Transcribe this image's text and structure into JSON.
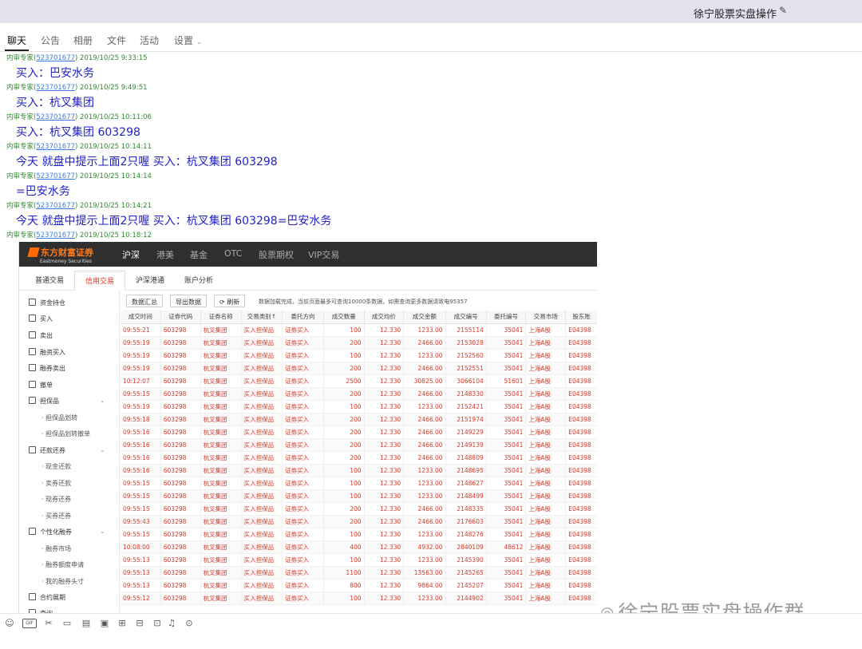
{
  "window": {
    "title": "徐宁股票实盘操作"
  },
  "tabs": [
    {
      "label": "聊天"
    },
    {
      "label": "公告"
    },
    {
      "label": "相册"
    },
    {
      "label": "文件"
    },
    {
      "label": "活动"
    },
    {
      "label": "设置"
    }
  ],
  "messages": [
    {
      "sender": "内审专家",
      "qq": "523701677",
      "time": "2019/10/25 9:33:15",
      "text": "买入：巴安水务"
    },
    {
      "sender": "内审专家",
      "qq": "523701677",
      "time": "2019/10/25 9:49:51",
      "text": "买入：杭叉集团"
    },
    {
      "sender": "内审专家",
      "qq": "523701677",
      "time": "2019/10/25 10:11:06",
      "text": "买入：杭叉集团 603298"
    },
    {
      "sender": "内审专家",
      "qq": "523701677",
      "time": "2019/10/25 10:14:11",
      "text": "今天 就盘中提示上面2只喔 买入：杭叉集团 603298"
    },
    {
      "sender": "内审专家",
      "qq": "523701677",
      "time": "2019/10/25 10:14:14",
      "text": "=巴安水务"
    },
    {
      "sender": "内审专家",
      "qq": "523701677",
      "time": "2019/10/25 10:14:21",
      "text": "今天 就盘中提示上面2只喔 买入：杭叉集团 603298=巴安水务"
    },
    {
      "sender": "内审专家",
      "qq": "523701677",
      "time": "2019/10/25 10:18:12",
      "text": ""
    }
  ],
  "screenshot": {
    "logo": "东方财富证券",
    "logo_sub": "Eastmoney Securities",
    "nav": [
      "沪深",
      "港美",
      "基金",
      "OTC",
      "股票期权",
      "VIP交易"
    ],
    "subtabs": [
      "普通交易",
      "信用交易",
      "沪深港通",
      "账户分析"
    ],
    "sidebar": [
      {
        "label": "资金持仓"
      },
      {
        "label": "买入"
      },
      {
        "label": "卖出"
      },
      {
        "label": "融资买入"
      },
      {
        "label": "融券卖出"
      },
      {
        "label": "撤单"
      },
      {
        "label": "担保品"
      },
      {
        "label": "担保品划转"
      },
      {
        "label": "担保品划转撤单"
      },
      {
        "label": "还款还券"
      },
      {
        "label": "现金还款"
      },
      {
        "label": "卖券还款"
      },
      {
        "label": "现券还券"
      },
      {
        "label": "买券还券"
      },
      {
        "label": "个性化融券"
      },
      {
        "label": "融券市场"
      },
      {
        "label": "融券额度申请"
      },
      {
        "label": "我的融券头寸"
      },
      {
        "label": "合约展期"
      },
      {
        "label": "查询"
      }
    ],
    "toolbar": {
      "summary": "数据汇总",
      "export": "导出数据",
      "refresh": "⟳ 刷新",
      "message": "数据加载完成，当前页面最多可查询10000条数据，如需查询更多数据请致电95357"
    },
    "columns": [
      "成交时间",
      "证券代码",
      "证券名称",
      "交易类别↑",
      "委托方向",
      "成交数量",
      "成交均价",
      "成交金额",
      "成交编号",
      "委托编号",
      "交易市场",
      "股东账"
    ],
    "rows": [
      [
        "09:55:21",
        "603298",
        "杭叉集团",
        "买入担保品",
        "证券买入",
        "100",
        "12.330",
        "1233.00",
        "2155114",
        "35041",
        "上海A股",
        "E04398"
      ],
      [
        "09:55:19",
        "603298",
        "杭叉集团",
        "买入担保品",
        "证券买入",
        "200",
        "12.330",
        "2466.00",
        "2153028",
        "35041",
        "上海A股",
        "E04398"
      ],
      [
        "09:55:19",
        "603298",
        "杭叉集团",
        "买入担保品",
        "证券买入",
        "100",
        "12.330",
        "1233.00",
        "2152560",
        "35041",
        "上海A股",
        "E04398"
      ],
      [
        "09:55:19",
        "603298",
        "杭叉集团",
        "买入担保品",
        "证券买入",
        "200",
        "12.330",
        "2466.00",
        "2152551",
        "35041",
        "上海A股",
        "E04398"
      ],
      [
        "10:12:07",
        "603298",
        "杭叉集团",
        "买入担保品",
        "证券买入",
        "2500",
        "12.330",
        "30825.00",
        "3066104",
        "51601",
        "上海A股",
        "E04398"
      ],
      [
        "09:55:15",
        "603298",
        "杭叉集团",
        "买入担保品",
        "证券买入",
        "200",
        "12.330",
        "2466.00",
        "2148330",
        "35041",
        "上海A股",
        "E04398"
      ],
      [
        "09:55:19",
        "603298",
        "杭叉集团",
        "买入担保品",
        "证券买入",
        "100",
        "12.330",
        "1233.00",
        "2152421",
        "35041",
        "上海A股",
        "E04398"
      ],
      [
        "09:55:18",
        "603298",
        "杭叉集团",
        "买入担保品",
        "证券买入",
        "200",
        "12.330",
        "2466.00",
        "2151974",
        "35041",
        "上海A股",
        "E04398"
      ],
      [
        "09:55:16",
        "603298",
        "杭叉集团",
        "买入担保品",
        "证券买入",
        "200",
        "12.330",
        "2466.00",
        "2149229",
        "35041",
        "上海A股",
        "E04398"
      ],
      [
        "09:55:16",
        "603298",
        "杭叉集团",
        "买入担保品",
        "证券买入",
        "200",
        "12.330",
        "2466.00",
        "2149139",
        "35041",
        "上海A股",
        "E04398"
      ],
      [
        "09:55:16",
        "603298",
        "杭叉集团",
        "买入担保品",
        "证券买入",
        "200",
        "12.330",
        "2466.00",
        "2148809",
        "35041",
        "上海A股",
        "E04398"
      ],
      [
        "09:55:16",
        "603298",
        "杭叉集团",
        "买入担保品",
        "证券买入",
        "100",
        "12.330",
        "1233.00",
        "2148695",
        "35041",
        "上海A股",
        "E04398"
      ],
      [
        "09:55:15",
        "603298",
        "杭叉集团",
        "买入担保品",
        "证券买入",
        "100",
        "12.330",
        "1233.00",
        "2148627",
        "35041",
        "上海A股",
        "E04398"
      ],
      [
        "09:55:15",
        "603298",
        "杭叉集团",
        "买入担保品",
        "证券买入",
        "100",
        "12.330",
        "1233.00",
        "2148499",
        "35041",
        "上海A股",
        "E04398"
      ],
      [
        "09:55:15",
        "603298",
        "杭叉集团",
        "买入担保品",
        "证券买入",
        "200",
        "12.330",
        "2466.00",
        "2148335",
        "35041",
        "上海A股",
        "E04398"
      ],
      [
        "09:55:43",
        "603298",
        "杭叉集团",
        "买入担保品",
        "证券买入",
        "200",
        "12.330",
        "2466.00",
        "2176603",
        "35041",
        "上海A股",
        "E04398"
      ],
      [
        "09:55:15",
        "603298",
        "杭叉集团",
        "买入担保品",
        "证券买入",
        "100",
        "12.330",
        "1233.00",
        "2148276",
        "35041",
        "上海A股",
        "E04398"
      ],
      [
        "10:08:00",
        "603298",
        "杭叉集团",
        "买入担保品",
        "证券买入",
        "400",
        "12.330",
        "4932.00",
        "2840109",
        "48612",
        "上海A股",
        "E04398"
      ],
      [
        "09:55:13",
        "603298",
        "杭叉集团",
        "买入担保品",
        "证券买入",
        "100",
        "12.330",
        "1233.00",
        "2145390",
        "35041",
        "上海A股",
        "E04398"
      ],
      [
        "09:55:13",
        "603298",
        "杭叉集团",
        "买入担保品",
        "证券买入",
        "1100",
        "12.330",
        "13563.00",
        "2145265",
        "35041",
        "上海A股",
        "E04398"
      ],
      [
        "09:55:13",
        "603298",
        "杭叉集团",
        "买入担保品",
        "证券买入",
        "800",
        "12.330",
        "9864.00",
        "2145207",
        "35041",
        "上海A股",
        "E04398"
      ],
      [
        "09:55:12",
        "603298",
        "杭叉集团",
        "买入担保品",
        "证券买入",
        "100",
        "12.330",
        "1233.00",
        "2144902",
        "35041",
        "上海A股",
        "E04398"
      ]
    ]
  },
  "watermark": "徐宁股票实盘操作群",
  "bottombar": [
    "smile-icon",
    "gif-icon",
    "scissors-icon",
    "folder-icon",
    "book-icon",
    "image-icon",
    "bag-icon",
    "gift-icon",
    "clipboard-icon",
    "bell-icon",
    "more-icon"
  ]
}
